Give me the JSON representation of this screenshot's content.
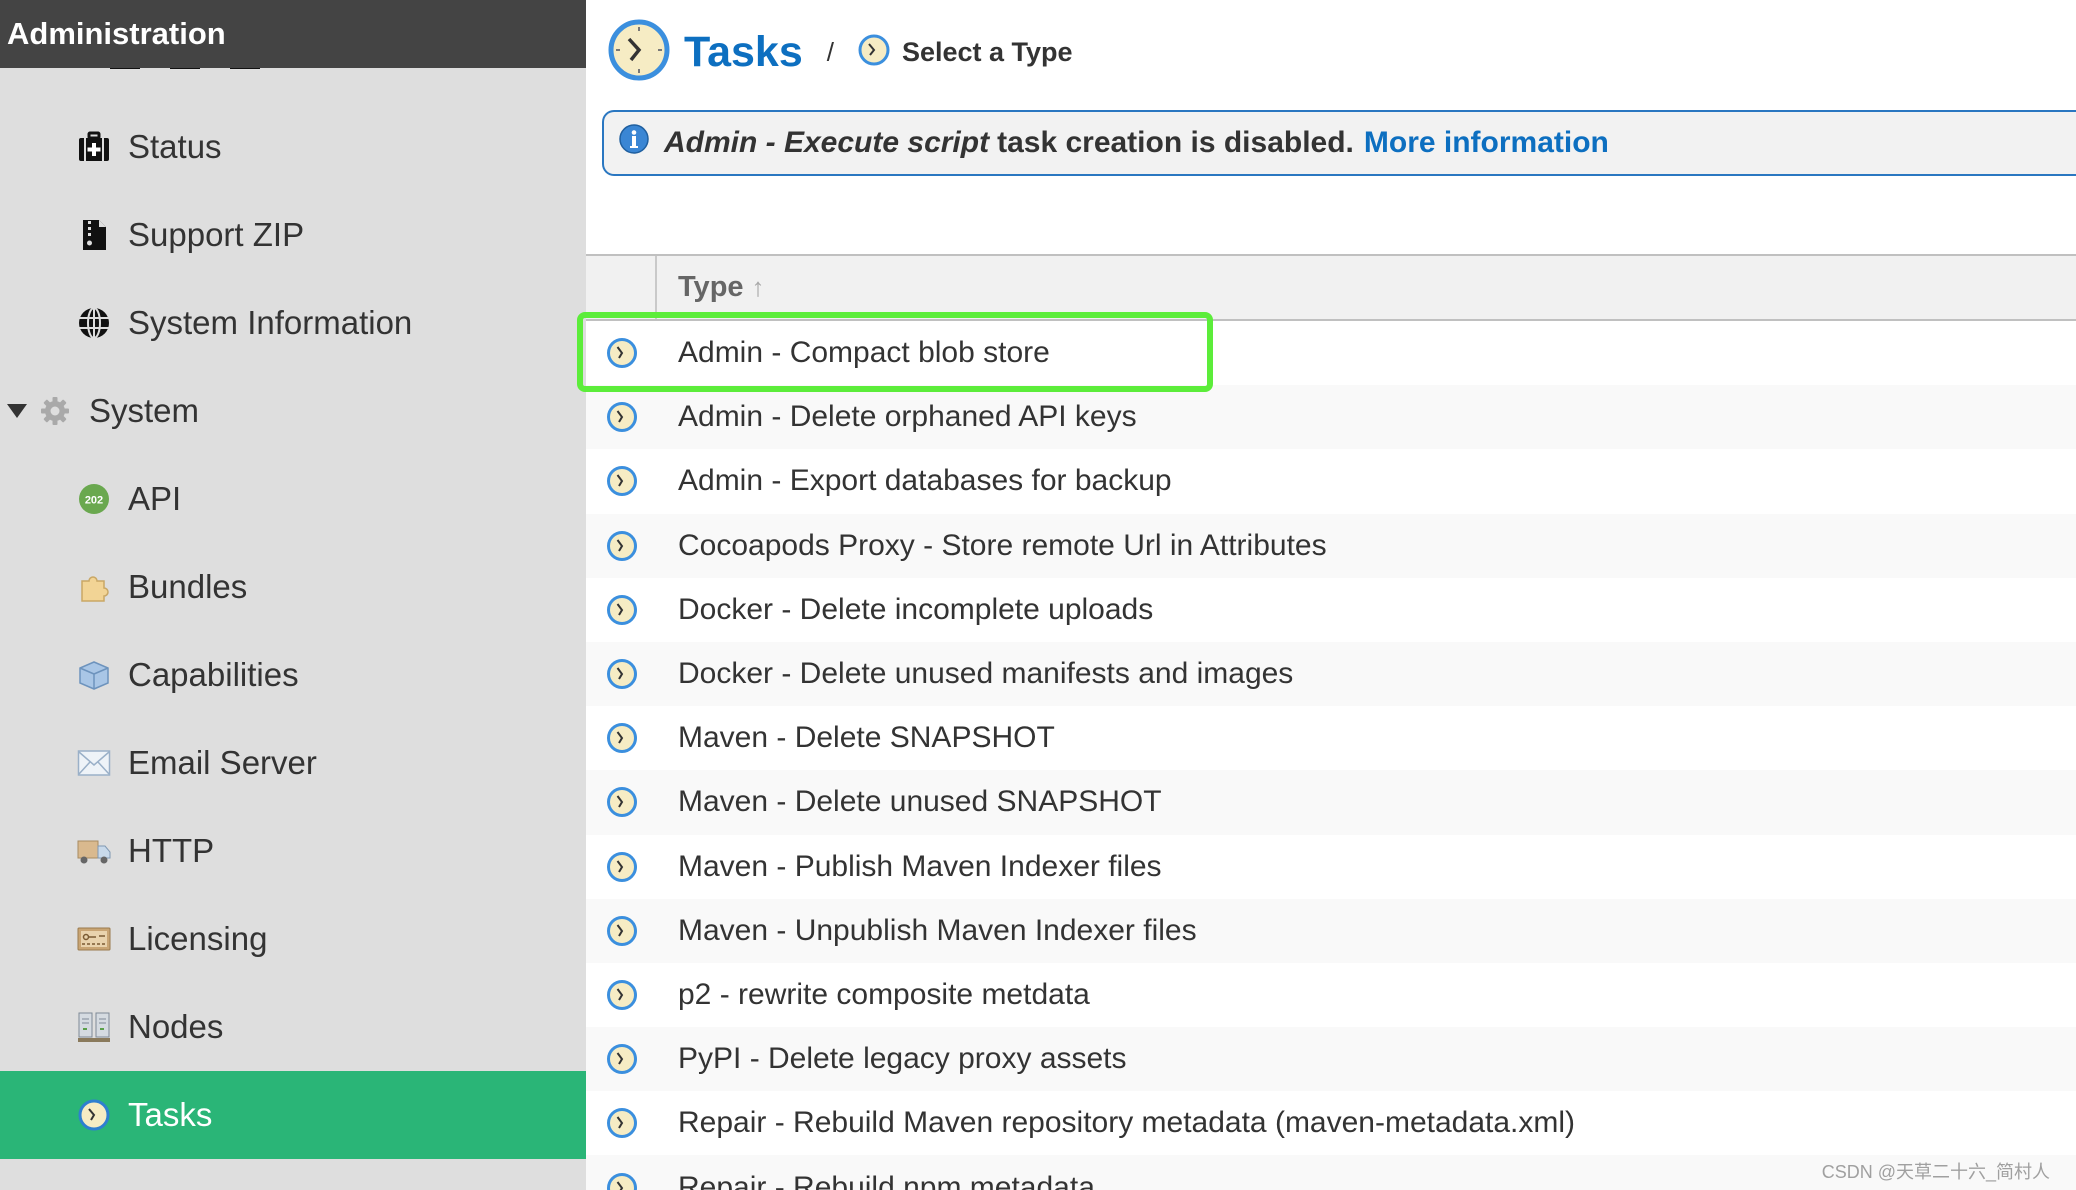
{
  "sidebar": {
    "header": "Administration",
    "items": [
      {
        "label": "Status",
        "icon": "first-aid-kit-icon",
        "level": 2,
        "active": false
      },
      {
        "label": "Support ZIP",
        "icon": "zip-file-icon",
        "level": 2,
        "active": false
      },
      {
        "label": "System Information",
        "icon": "globe-icon",
        "level": 2,
        "active": false
      },
      {
        "label": "System",
        "icon": "gear-icon",
        "level": 1,
        "expanded": true,
        "active": false
      },
      {
        "label": "API",
        "icon": "api-badge-icon",
        "level": 2,
        "active": false
      },
      {
        "label": "Bundles",
        "icon": "puzzle-piece-icon",
        "level": 2,
        "active": false
      },
      {
        "label": "Capabilities",
        "icon": "box-icon",
        "level": 2,
        "active": false
      },
      {
        "label": "Email Server",
        "icon": "envelope-icon",
        "level": 2,
        "active": false
      },
      {
        "label": "HTTP",
        "icon": "truck-icon",
        "level": 2,
        "active": false
      },
      {
        "label": "Licensing",
        "icon": "license-card-icon",
        "level": 2,
        "active": false
      },
      {
        "label": "Nodes",
        "icon": "server-nodes-icon",
        "level": 2,
        "active": false
      },
      {
        "label": "Tasks",
        "icon": "clock-icon",
        "level": 2,
        "active": true
      }
    ],
    "api_badge_text": "202"
  },
  "breadcrumb": {
    "title": "Tasks",
    "separator": "/",
    "current": "Select a Type"
  },
  "banner": {
    "italic_text": "Admin - Execute script",
    "text": "task creation is disabled.",
    "link": "More information"
  },
  "grid": {
    "column_header": "Type",
    "sort_indicator": "↑",
    "sort_direction": "ascending",
    "rows": [
      "Admin - Compact blob store",
      "Admin - Delete orphaned API keys",
      "Admin - Export databases for backup",
      "Cocoapods Proxy - Store remote Url in Attributes",
      "Docker - Delete incomplete uploads",
      "Docker - Delete unused manifests and images",
      "Maven - Delete SNAPSHOT",
      "Maven - Delete unused SNAPSHOT",
      "Maven - Publish Maven Indexer files",
      "Maven - Unpublish Maven Indexer files",
      "p2 - rewrite composite metdata",
      "PyPI - Delete legacy proxy assets",
      "Repair - Rebuild Maven repository metadata (maven-metadata.xml)",
      "Repair - Rebuild npm metadata"
    ],
    "highlighted_row": "Admin - Compact blob store"
  },
  "colors": {
    "accent": "#0d6fc0",
    "active_nav": "#2ab577",
    "highlight": "#5ced3a",
    "sidebar_header": "#444444"
  },
  "watermark": "CSDN @天草二十六_简村人"
}
